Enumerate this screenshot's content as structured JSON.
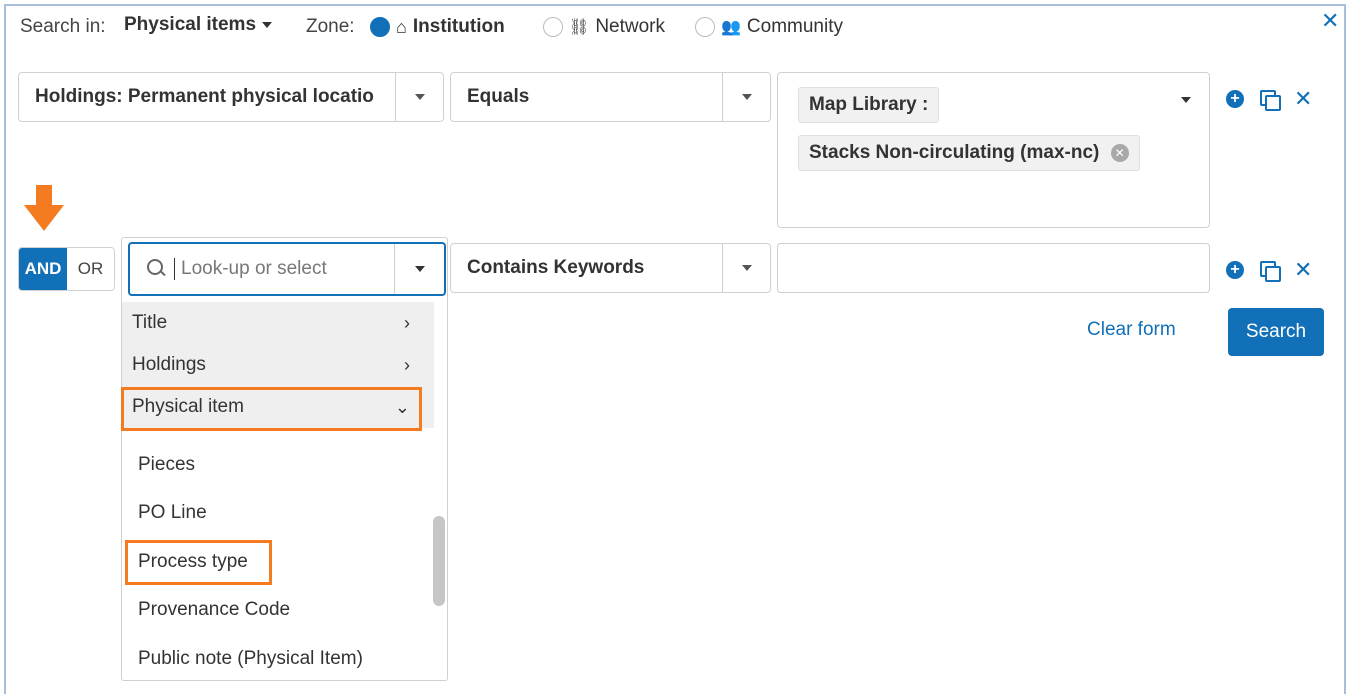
{
  "header": {
    "search_in_label": "Search in:",
    "scope_value": "Physical items",
    "zone_label": "Zone:",
    "zones": [
      {
        "label": "Institution",
        "selected": true
      },
      {
        "label": "Network",
        "selected": false
      },
      {
        "label": "Community",
        "selected": false
      }
    ],
    "close_icon": "close-icon"
  },
  "row1": {
    "field": "Holdings: Permanent physical locatio",
    "operator": "Equals",
    "value_chips": [
      "Map Library :",
      "Stacks Non-circulating (max-nc)"
    ]
  },
  "row2": {
    "and_label": "AND",
    "or_label": "OR",
    "lookup_placeholder": "Look-up or select",
    "operator": "Contains Keywords",
    "value": ""
  },
  "dropdown": {
    "categories": [
      "Title",
      "Holdings",
      "Physical item"
    ],
    "items": [
      "Pieces",
      "PO Line",
      "Process type",
      "Provenance Code",
      "Public note (Physical Item)"
    ]
  },
  "actions": {
    "clear_form": "Clear form",
    "search": "Search"
  },
  "colors": {
    "accent": "#1170b8",
    "highlight": "#f47b20"
  }
}
